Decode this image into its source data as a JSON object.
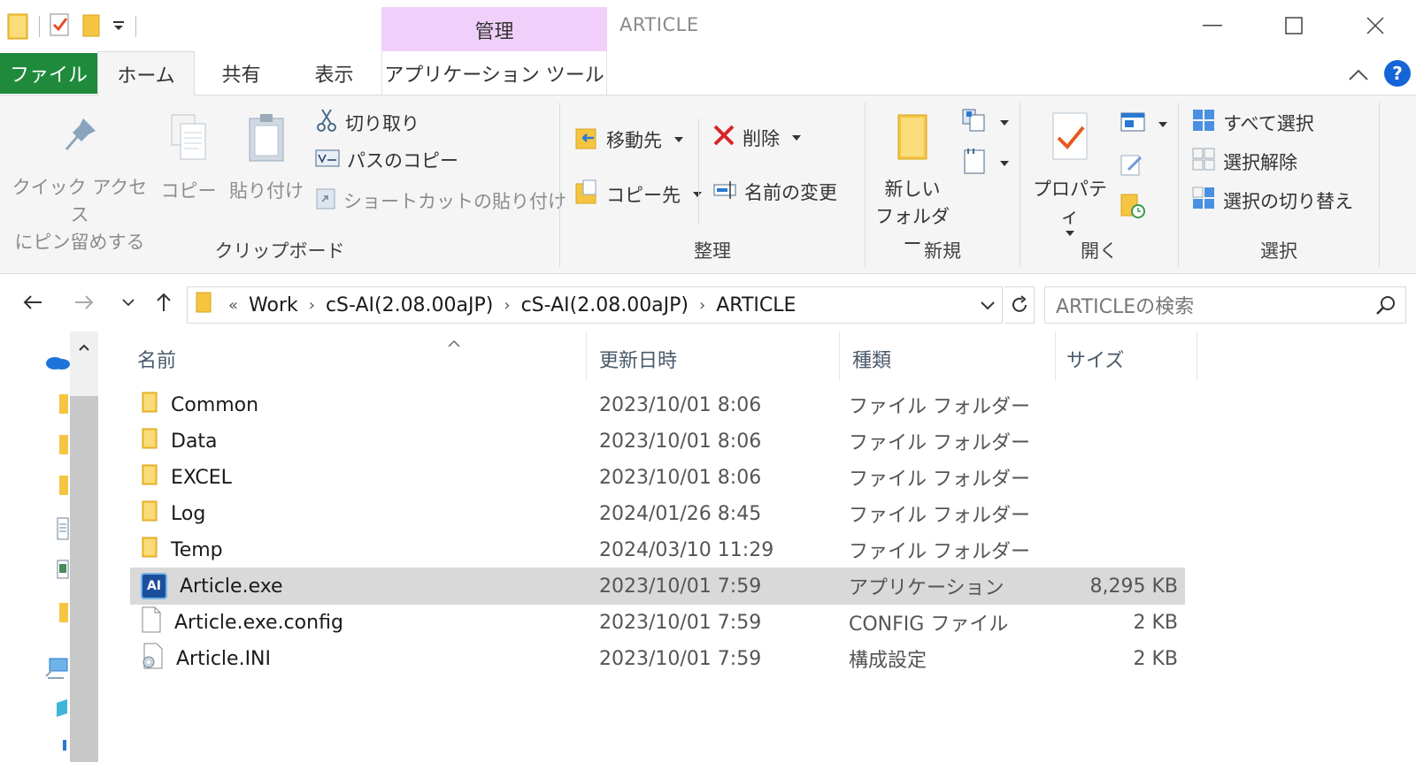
{
  "window": {
    "title": "ARTICLE",
    "context_tab_group": "管理"
  },
  "ribbon_tabs": {
    "file": "ファイル",
    "home": "ホーム",
    "share": "共有",
    "view": "表示",
    "app_tools": "アプリケーション ツール"
  },
  "ribbon": {
    "clipboard": {
      "label": "クリップボード",
      "pin_line1": "クイック アクセス",
      "pin_line2": "にピン留めする",
      "copy": "コピー",
      "paste": "貼り付け",
      "cut": "切り取り",
      "copy_path": "パスのコピー",
      "paste_shortcut": "ショートカットの貼り付け"
    },
    "organize": {
      "label": "整理",
      "move_to": "移動先",
      "copy_to": "コピー先",
      "delete": "削除",
      "rename": "名前の変更"
    },
    "new": {
      "label": "新規",
      "new_folder_line1": "新しい",
      "new_folder_line2": "フォルダー"
    },
    "open": {
      "label": "開く",
      "properties": "プロパティ"
    },
    "select": {
      "label": "選択",
      "select_all": "すべて選択",
      "select_none": "選択解除",
      "invert": "選択の切り替え"
    }
  },
  "address": {
    "overflow": "«",
    "crumbs": [
      "Work",
      "cS-AI(2.08.00aJP)",
      "cS-AI(2.08.00aJP)",
      "ARTICLE"
    ],
    "search_placeholder": "ARTICLEの検索"
  },
  "columns": {
    "name": "名前",
    "date": "更新日時",
    "type": "種類",
    "size": "サイズ"
  },
  "files": [
    {
      "name": "Common",
      "date": "2023/10/01 8:06",
      "type": "ファイル フォルダー",
      "size": "",
      "icon": "folder-icon"
    },
    {
      "name": "Data",
      "date": "2023/10/01 8:06",
      "type": "ファイル フォルダー",
      "size": "",
      "icon": "folder-icon"
    },
    {
      "name": "EXCEL",
      "date": "2023/10/01 8:06",
      "type": "ファイル フォルダー",
      "size": "",
      "icon": "folder-icon"
    },
    {
      "name": "Log",
      "date": "2024/01/26 8:45",
      "type": "ファイル フォルダー",
      "size": "",
      "icon": "folder-icon"
    },
    {
      "name": "Temp",
      "date": "2024/03/10 11:29",
      "type": "ファイル フォルダー",
      "size": "",
      "icon": "folder-icon"
    },
    {
      "name": "Article.exe",
      "date": "2023/10/01 7:59",
      "type": "アプリケーション",
      "size": "8,295 KB",
      "icon": "app-ai-icon"
    },
    {
      "name": "Article.exe.config",
      "date": "2023/10/01 7:59",
      "type": "CONFIG ファイル",
      "size": "2 KB",
      "icon": "file-icon"
    },
    {
      "name": "Article.INI",
      "date": "2023/10/01 7:59",
      "type": "構成設定",
      "size": "2 KB",
      "icon": "settings-file-icon"
    }
  ],
  "app_icon_text": "AI",
  "colors": {
    "file_tab": "#1f8a3c",
    "manage_tab": "#f0d0fa",
    "selected_row": "#d9d9d9",
    "help": "#1565d8",
    "folder": "#f5c542"
  }
}
